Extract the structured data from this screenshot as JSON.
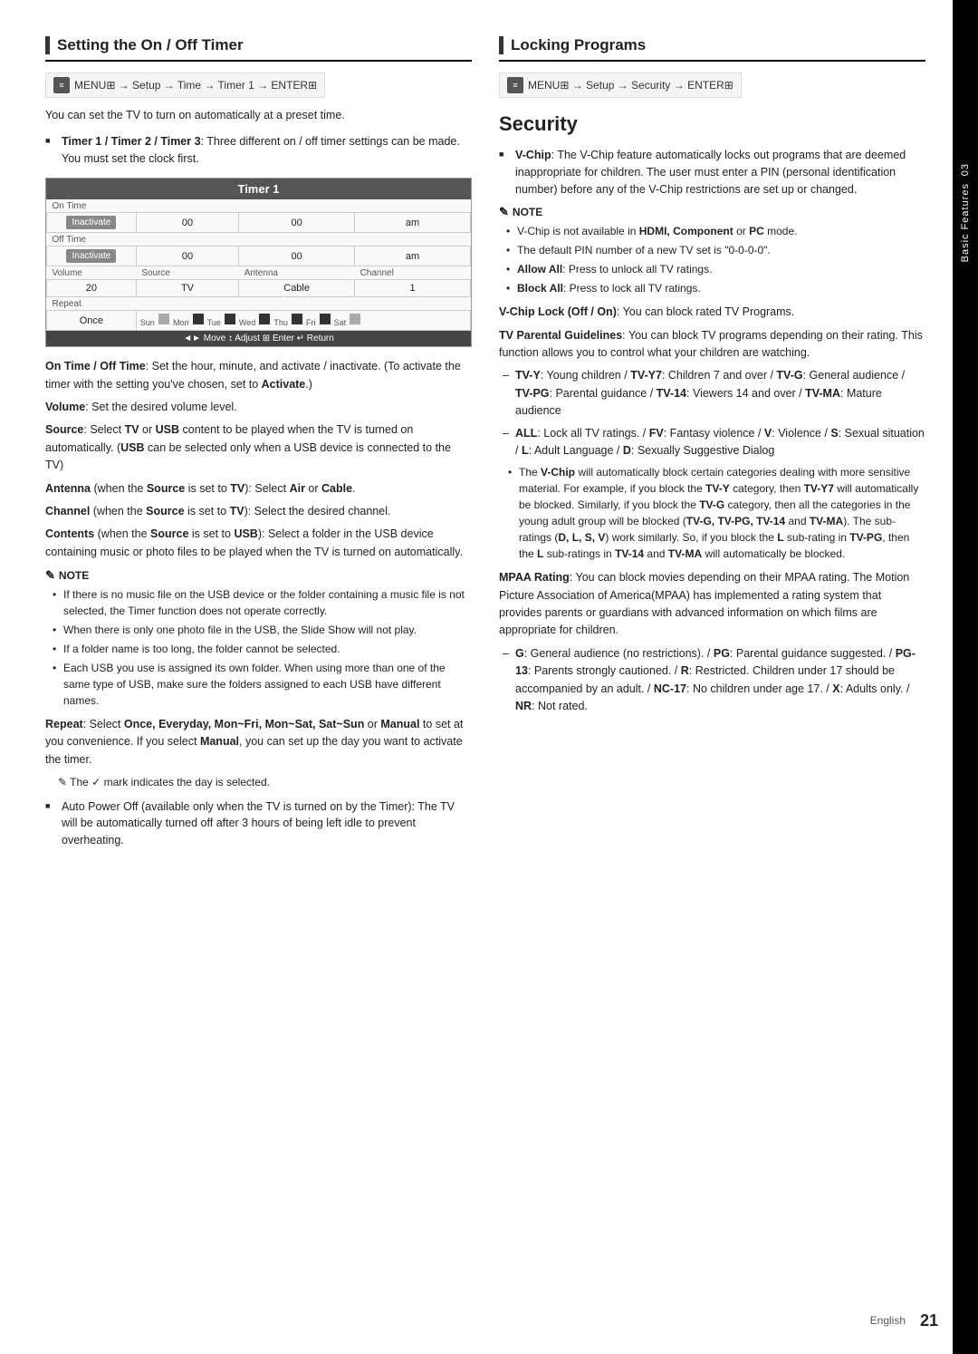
{
  "page": {
    "number": "21",
    "language": "English",
    "chapter": "03",
    "chapter_label": "Basic Features"
  },
  "left": {
    "section_title": "Setting the On / Off Timer",
    "menu_path": "MENU⊞ → Setup → Time → Timer 1 → ENTER⊞",
    "intro": "You can set the TV to turn on automatically at a preset time.",
    "bullet1_label": "Timer 1 / Timer 2 / Timer 3",
    "bullet1_text": ": Three different on / off timer settings can be made. You must set the clock first.",
    "timer": {
      "title": "Timer 1",
      "on_time_label": "On Time",
      "off_time_label": "Off Time",
      "inactivate": "Inactivate",
      "volume_label": "Volume",
      "volume_val": "20",
      "source_label": "Source",
      "source_val": "TV",
      "antenna_label": "Antenna",
      "antenna_val": "Cable",
      "channel_label": "Channel",
      "channel_val": "1",
      "repeat_label": "Repeat",
      "repeat_val": "Once",
      "days": [
        "Sun",
        "Mon",
        "Tue",
        "Wed",
        "Thu",
        "Fri",
        "Sat"
      ],
      "nav": "◄► Move   ↕ Adjust   ⊞ Enter   ↵ Return"
    },
    "on_off_time": "<b>On Time / Off Time</b>: Set the hour, minute, and activate / inactivate. (To activate the timer with the setting you've chosen, set to <b>Activate</b>.)",
    "volume_text": "<b>Volume</b>: Set the desired volume level.",
    "source_text": "<b>Source</b>: Select <b>TV</b> or <b>USB</b> content to be played when the TV is turned on automatically. (<b>USB</b> can be selected only when a USB device is connected to the TV)",
    "antenna_text": "<b>Antenna</b> (when the <b>Source</b> is set to <b>TV</b>): Select <b>Air</b> or <b>Cable</b>.",
    "channel_text": "<b>Channel</b> (when the <b>Source</b> is set to <b>TV</b>): Select the desired channel.",
    "contents_text": "<b>Contents</b> (when the <b>Source</b> is set to <b>USB</b>): Select a folder in the USB device containing music or photo files to be played when the TV is turned on automatically.",
    "note_label": "NOTE",
    "notes": [
      "If there is no music file on the USB device or the folder containing a music file is not selected, the Timer function does not operate correctly.",
      "When there is only one photo file in the USB, the Slide Show will not play.",
      "If a folder name is too long, the folder cannot be selected.",
      "Each USB you use is assigned its own folder. When using more than one of the same type of USB, make sure the folders assigned to each USB have different names."
    ],
    "repeat_text": "<b>Repeat</b>: Select <b>Once, Everyday, Mon~Fri, Mon~Sat, Sat~Sun</b> or <b>Manual</b> to set at you convenience. If you select <b>Manual</b>, you can set up the day you want to activate the timer.",
    "check_note": "The ✓ mark indicates the day is selected.",
    "auto_power_off": "Auto Power Off (available only when the TV is turned on by the Timer): The TV will be automatically turned off after 3 hours of being left idle to prevent overheating."
  },
  "right": {
    "section_title": "Locking Programs",
    "menu_path": "MENU⊞ → Setup → Security → ENTER⊞",
    "security_title": "Security",
    "vchip_text": "<b>V-Chip</b>: The V-Chip feature automatically locks out programs that are deemed inappropriate for children. The user must enter a PIN (personal identification number) before any of the V-Chip restrictions are set up or changed.",
    "note_label": "NOTE",
    "vchip_notes": [
      "V-Chip is not available in <b>HDMI, Component</b> or <b>PC</b> mode.",
      "The default PIN number of a new TV set is “0-0-0-0”.",
      "<b>Allow All</b>: Press to unlock all TV ratings.",
      "<b>Block All</b>: Press to lock all TV ratings."
    ],
    "vchip_lock": "<b>V-Chip Lock (Off / On)</b>: You can block rated TV Programs.",
    "tv_parental": "<b>TV Parental Guidelines</b>: You can block TV programs depending on their rating. This function allows you to control what your children are watching.",
    "tv_ratings": [
      "<b>TV-Y</b>: Young children / <b>TV-Y7</b>: Children 7 and over / <b>TV-G</b>: General audience / <b>TV-PG</b>: Parental guidance / <b>TV-14</b>: Viewers 14 and over / <b>TV-MA</b>: Mature audience",
      "<b>ALL</b>: Lock all TV ratings. / <b>FV</b>: Fantasy violence / <b>V</b>: Violence / <b>S</b>: Sexual situation / <b>L</b>: Adult Language / <b>D</b>: Sexually Suggestive Dialog"
    ],
    "vchip_auto_note": "The <b>V-Chip</b> will automatically block certain categories dealing with more sensitive material. For example, if you block the <b>TV-Y</b> category, then <b>TV-Y7</b> will automatically be blocked. Similarly, if you block the <b>TV-G</b> category, then all the categories in the young adult group will be blocked (<b>TV-G, TV-PG, TV-14</b> and <b>TV-MA</b>). The sub-ratings (<b>D, L, S, V</b>) work similarly. So, if you block the <b>L</b> sub-rating in <b>TV-PG</b>, then the <b>L</b> sub-ratings in <b>TV-14</b> and <b>TV-MA</b> will automatically be blocked.",
    "mpaa_text": "<b>MPAA Rating</b>: You can block movies depending on their MPAA rating. The Motion Picture Association of America(MPAA) has implemented a rating system that provides parents or guardians with advanced information on which films are appropriate for children.",
    "mpaa_ratings": "<b>G</b>: General audience (no restrictions). / <b>PG</b>: Parental guidance suggested. / <b>PG-13</b>: Parents strongly cautioned. / <b>R</b>: Restricted. Children under 17 should be accompanied by an adult. / <b>NC-17</b>: No children under age 17. / <b>X</b>: Adults only. / <b>NR</b>: Not rated."
  }
}
